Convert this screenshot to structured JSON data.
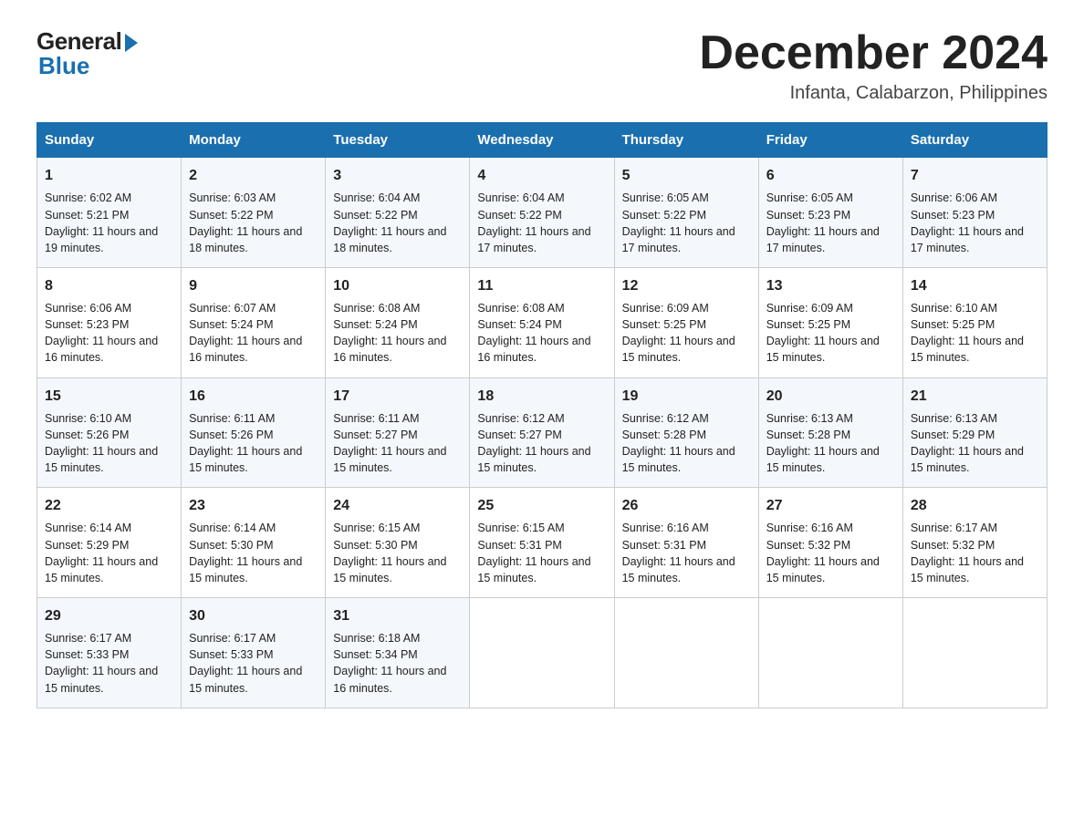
{
  "logo": {
    "general": "General",
    "blue": "Blue"
  },
  "header": {
    "month_year": "December 2024",
    "location": "Infanta, Calabarzon, Philippines"
  },
  "days_of_week": [
    "Sunday",
    "Monday",
    "Tuesday",
    "Wednesday",
    "Thursday",
    "Friday",
    "Saturday"
  ],
  "weeks": [
    [
      {
        "day": "1",
        "sunrise": "6:02 AM",
        "sunset": "5:21 PM",
        "daylight": "11 hours and 19 minutes."
      },
      {
        "day": "2",
        "sunrise": "6:03 AM",
        "sunset": "5:22 PM",
        "daylight": "11 hours and 18 minutes."
      },
      {
        "day": "3",
        "sunrise": "6:04 AM",
        "sunset": "5:22 PM",
        "daylight": "11 hours and 18 minutes."
      },
      {
        "day": "4",
        "sunrise": "6:04 AM",
        "sunset": "5:22 PM",
        "daylight": "11 hours and 17 minutes."
      },
      {
        "day": "5",
        "sunrise": "6:05 AM",
        "sunset": "5:22 PM",
        "daylight": "11 hours and 17 minutes."
      },
      {
        "day": "6",
        "sunrise": "6:05 AM",
        "sunset": "5:23 PM",
        "daylight": "11 hours and 17 minutes."
      },
      {
        "day": "7",
        "sunrise": "6:06 AM",
        "sunset": "5:23 PM",
        "daylight": "11 hours and 17 minutes."
      }
    ],
    [
      {
        "day": "8",
        "sunrise": "6:06 AM",
        "sunset": "5:23 PM",
        "daylight": "11 hours and 16 minutes."
      },
      {
        "day": "9",
        "sunrise": "6:07 AM",
        "sunset": "5:24 PM",
        "daylight": "11 hours and 16 minutes."
      },
      {
        "day": "10",
        "sunrise": "6:08 AM",
        "sunset": "5:24 PM",
        "daylight": "11 hours and 16 minutes."
      },
      {
        "day": "11",
        "sunrise": "6:08 AM",
        "sunset": "5:24 PM",
        "daylight": "11 hours and 16 minutes."
      },
      {
        "day": "12",
        "sunrise": "6:09 AM",
        "sunset": "5:25 PM",
        "daylight": "11 hours and 15 minutes."
      },
      {
        "day": "13",
        "sunrise": "6:09 AM",
        "sunset": "5:25 PM",
        "daylight": "11 hours and 15 minutes."
      },
      {
        "day": "14",
        "sunrise": "6:10 AM",
        "sunset": "5:25 PM",
        "daylight": "11 hours and 15 minutes."
      }
    ],
    [
      {
        "day": "15",
        "sunrise": "6:10 AM",
        "sunset": "5:26 PM",
        "daylight": "11 hours and 15 minutes."
      },
      {
        "day": "16",
        "sunrise": "6:11 AM",
        "sunset": "5:26 PM",
        "daylight": "11 hours and 15 minutes."
      },
      {
        "day": "17",
        "sunrise": "6:11 AM",
        "sunset": "5:27 PM",
        "daylight": "11 hours and 15 minutes."
      },
      {
        "day": "18",
        "sunrise": "6:12 AM",
        "sunset": "5:27 PM",
        "daylight": "11 hours and 15 minutes."
      },
      {
        "day": "19",
        "sunrise": "6:12 AM",
        "sunset": "5:28 PM",
        "daylight": "11 hours and 15 minutes."
      },
      {
        "day": "20",
        "sunrise": "6:13 AM",
        "sunset": "5:28 PM",
        "daylight": "11 hours and 15 minutes."
      },
      {
        "day": "21",
        "sunrise": "6:13 AM",
        "sunset": "5:29 PM",
        "daylight": "11 hours and 15 minutes."
      }
    ],
    [
      {
        "day": "22",
        "sunrise": "6:14 AM",
        "sunset": "5:29 PM",
        "daylight": "11 hours and 15 minutes."
      },
      {
        "day": "23",
        "sunrise": "6:14 AM",
        "sunset": "5:30 PM",
        "daylight": "11 hours and 15 minutes."
      },
      {
        "day": "24",
        "sunrise": "6:15 AM",
        "sunset": "5:30 PM",
        "daylight": "11 hours and 15 minutes."
      },
      {
        "day": "25",
        "sunrise": "6:15 AM",
        "sunset": "5:31 PM",
        "daylight": "11 hours and 15 minutes."
      },
      {
        "day": "26",
        "sunrise": "6:16 AM",
        "sunset": "5:31 PM",
        "daylight": "11 hours and 15 minutes."
      },
      {
        "day": "27",
        "sunrise": "6:16 AM",
        "sunset": "5:32 PM",
        "daylight": "11 hours and 15 minutes."
      },
      {
        "day": "28",
        "sunrise": "6:17 AM",
        "sunset": "5:32 PM",
        "daylight": "11 hours and 15 minutes."
      }
    ],
    [
      {
        "day": "29",
        "sunrise": "6:17 AM",
        "sunset": "5:33 PM",
        "daylight": "11 hours and 15 minutes."
      },
      {
        "day": "30",
        "sunrise": "6:17 AM",
        "sunset": "5:33 PM",
        "daylight": "11 hours and 15 minutes."
      },
      {
        "day": "31",
        "sunrise": "6:18 AM",
        "sunset": "5:34 PM",
        "daylight": "11 hours and 16 minutes."
      },
      null,
      null,
      null,
      null
    ]
  ]
}
